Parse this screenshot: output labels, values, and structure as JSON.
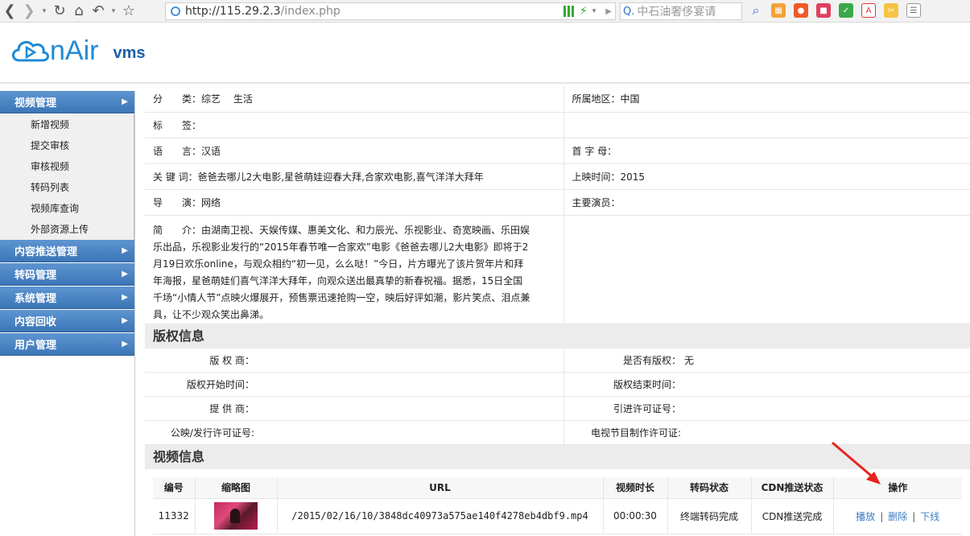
{
  "browser": {
    "url_host": "http://115.29.2.3",
    "url_path": "/index.php",
    "search_placeholder": "中石油奢侈宴请"
  },
  "logo": {
    "word": "nAir",
    "product": "vms"
  },
  "sidebar": {
    "video_mgmt": {
      "label": "视频管理",
      "items": [
        "新增视频",
        "提交审核",
        "审核视频",
        "转码列表",
        "视频库查询",
        "外部资源上传"
      ]
    },
    "menus": [
      "内容推送管理",
      "转码管理",
      "系统管理",
      "内容回收",
      "用户管理"
    ]
  },
  "info": {
    "category_label": "分　　类：",
    "category_value": "综艺　  生活",
    "region_label": "所属地区：",
    "region_value": "中国",
    "tags_label": "标　　签：",
    "tags_value": "",
    "language_label": "语　　言：",
    "language_value": "汉语",
    "initial_label": "首 字 母：",
    "initial_value": "",
    "keywords_label": "关 键 词：",
    "keywords_value": "爸爸去哪儿2大电影,星爸萌娃迎春大拜,合家欢电影,喜气洋洋大拜年",
    "release_label": "上映时间：",
    "release_value": "2015",
    "director_label": "导　　演：",
    "director_value": "网络",
    "actors_label": "主要演员：",
    "actors_value": "",
    "intro_label": "简　　介：",
    "intro_value": "由湖南卫视、天娱传媒、惠美文化、和力辰光、乐视影业、奇宽映画、乐田娱乐出品，乐视影业发行的“2015年春节唯一合家欢”电影《爸爸去哪儿2大电影》即将于2月19日欢乐online，与观众相约“初一见，么么哒！”今日，片方曝光了该片贺年片和拜年海报，星爸萌娃们喜气洋洋大拜年，向观众送出最真挚的新春祝福。据悉，15日全国千场“小情人节”点映火爆展开，预售票迅速抢购一空，映后好评如潮，影片笑点、泪点兼具，让不少观众笑出鼻涕。"
  },
  "copyright": {
    "title": "版权信息",
    "owner_label": "版 权 商：",
    "has_copyright_label": "是否有版权：",
    "has_copyright_value": "无",
    "start_label": "版权开始时间：",
    "end_label": "版权结束时间：",
    "provider_label": "提 供 商：",
    "import_license_label": "引进许可证号：",
    "release_license_label": "公映/发行许可证号:",
    "tv_license_label": "电视节目制作许可证:"
  },
  "video": {
    "title": "视频信息",
    "headers": [
      "编号",
      "缩略图",
      "URL",
      "视频时长",
      "转码状态",
      "CDN推送状态",
      "操作"
    ],
    "row": {
      "id": "11332",
      "url": "/2015/02/16/10/3848dc40973a575ae140f4278eb4dbf9.mp4",
      "duration": "00:00:30",
      "transcode_status": "终端转码完成",
      "cdn_status": "CDN推送完成",
      "op_play": "播放",
      "op_delete": "删除",
      "op_offline": "下线"
    }
  }
}
